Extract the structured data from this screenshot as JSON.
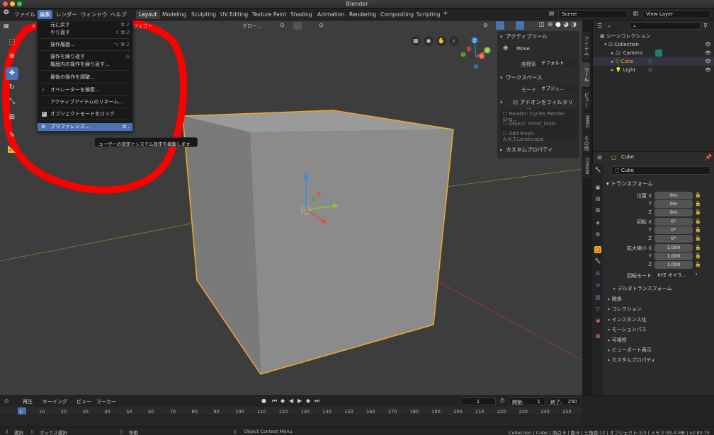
{
  "window": {
    "title": "Blender"
  },
  "menubar": {
    "file": "ファイル",
    "edit": "編集",
    "render": "レンダー",
    "window": "ウィンドウ",
    "help": "ヘルプ"
  },
  "workspaces": [
    "Layout",
    "Modeling",
    "Sculpting",
    "UV Editing",
    "Texture Paint",
    "Shading",
    "Animation",
    "Rendering",
    "Compositing",
    "Scripting"
  ],
  "scene": {
    "name": "Scene",
    "view_layer": "View Layer"
  },
  "viewport_header": {
    "orientation": "グロー...",
    "object_menu": "ジェクト",
    "object_label": "オ"
  },
  "edit_menu": {
    "items": [
      {
        "label": "元に戻す",
        "shortcut": "⌘ Z"
      },
      {
        "label": "やり直す",
        "shortcut": "⇧ ⌘ Z"
      },
      {
        "label": "操作履歴...",
        "shortcut": "⌥ ⌘ Z"
      },
      {
        "label": "操作を繰り返す",
        "shortcut": "G"
      },
      {
        "label": "履歴内の操作を繰り返す...",
        "shortcut": ""
      },
      {
        "label": "最後の操作を調整...",
        "shortcut": ""
      },
      {
        "label": "オペレーターを検索...",
        "shortcut": ""
      },
      {
        "label": "アクティブアイテムのリネーム...",
        "shortcut": ""
      },
      {
        "label": "オブジェクトモードをロック",
        "shortcut": ""
      },
      {
        "label": "プリファレンス...",
        "shortcut": "⌘ ,"
      }
    ],
    "tooltip": "ユーザーの設定とシステム設定を編集します."
  },
  "npanel": {
    "active_tool": "アクティブツール",
    "move": "Move",
    "coord_label": "座標系",
    "coord_value": "デフォルト",
    "workspace": "ワークスペース",
    "mode_label": "モード",
    "mode_value": "オブジェ...",
    "addon_filter": "アドオンをフィルタリング",
    "addons": [
      "Render: Cycles Render Eng...",
      "Object: mmd_tools",
      "Add Mesh: A.N.T.Landscape"
    ],
    "custom_props": "カスタムプロパティ",
    "tabs": [
      "アイテム",
      "ツール",
      "ビュー",
      "MMD",
      "その他",
      "Create"
    ]
  },
  "outliner": {
    "root": "シーンコレクション",
    "collection": "Collection",
    "items": [
      "Camera",
      "Cube",
      "Light"
    ]
  },
  "properties": {
    "object_name": "Cube",
    "data_name": "Cube",
    "transform": "トランスフォーム",
    "location_label": "位置 X",
    "rotation_label": "回転 X",
    "scale_label": "拡大縮小 X",
    "y": "Y",
    "z": "Z",
    "location": [
      "0m",
      "0m",
      "0m"
    ],
    "rotation": [
      "0°",
      "0°",
      "0°"
    ],
    "scale": [
      "1.000",
      "1.000",
      "1.000"
    ],
    "rot_mode_label": "回転モード",
    "rot_mode_value": "XYZ オイラ...",
    "delta": "デルタトランスフォーム",
    "sections": [
      "関係",
      "コレクション",
      "インスタンス化",
      "モーションパス",
      "可視性",
      "ビューポート表示",
      "カスタムプロパティ"
    ]
  },
  "timeline": {
    "play": "再生",
    "keying": "キーイング",
    "view": "ビュー",
    "marker": "マーカー",
    "current_frame": "1",
    "start_label": "開始:",
    "start_value": "1",
    "end_label": "終了:",
    "end_value": "250",
    "ticks": [
      "1",
      "10",
      "20",
      "30",
      "40",
      "50",
      "60",
      "70",
      "80",
      "90",
      "100",
      "110",
      "120",
      "130",
      "140",
      "150",
      "160",
      "170",
      "180",
      "190",
      "200",
      "210",
      "220",
      "230",
      "240",
      "250"
    ]
  },
  "statusbar": {
    "select": "選択",
    "box_select": "ボックス選択",
    "move": "移動",
    "context_menu": "Object Context Menu",
    "info": "Collection | Cube | 頂点:8 | 面:6 | 三角面:12 | オブジェクト:1/3 | メモリ:39.4 MB | v2.80.75"
  },
  "colors": {
    "accent": "#4772b3",
    "selection_outline": "#f5a623",
    "annotation": "#ff0000"
  }
}
